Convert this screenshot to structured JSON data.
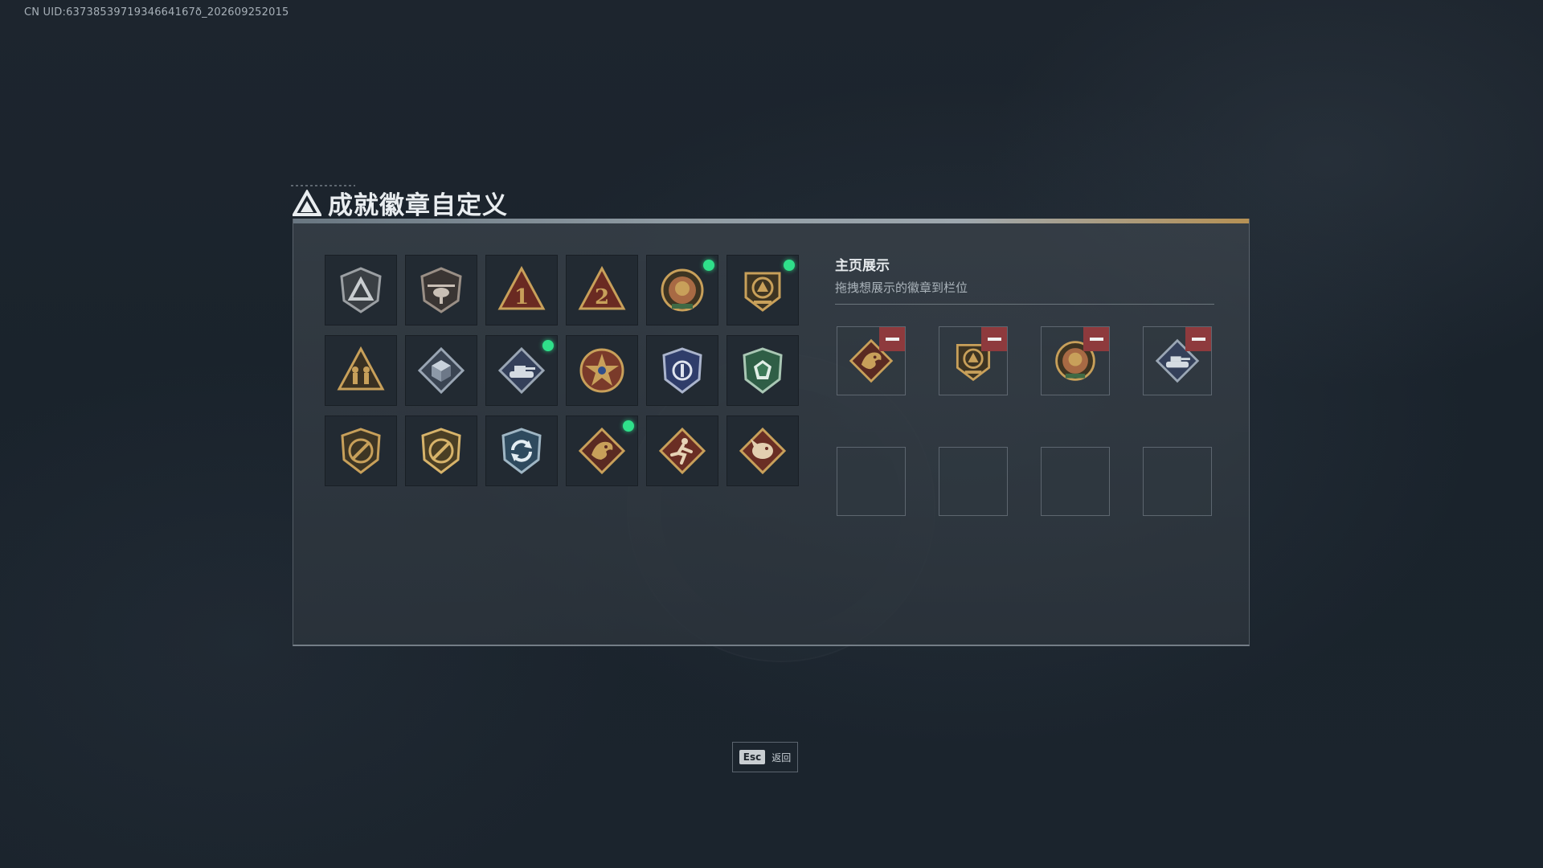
{
  "uid_text": "CN UID:6373853971934664167ð_202609252015",
  "title": "成就徽章自定义",
  "showcase": {
    "title": "主页展示",
    "subtitle": "拖拽想展示的徽章到栏位"
  },
  "esc": {
    "key": "Esc",
    "label": "返回"
  },
  "colors": {
    "new_dot": "#2fe08a",
    "remove_button": "#8e3a3d",
    "gold": "#c8a05a",
    "bronze": "#a86a44"
  },
  "badges": [
    {
      "icon": "delta-triangle-shield-badge-icon",
      "new": false
    },
    {
      "icon": "helicopter-shield-badge-icon",
      "new": false
    },
    {
      "icon": "rank-1-triangle-badge-icon",
      "new": false
    },
    {
      "icon": "rank-2-triangle-badge-icon",
      "new": false
    },
    {
      "icon": "lion-crest-badge-icon",
      "new": true
    },
    {
      "icon": "delta-force-2026-crest-badge-icon",
      "new": true
    },
    {
      "icon": "soldiers-triangle-badge-icon",
      "new": false
    },
    {
      "icon": "cube-diamond-badge-icon",
      "new": false
    },
    {
      "icon": "tank-diamond-badge-icon",
      "new": true
    },
    {
      "icon": "star-medal-badge-icon",
      "new": false
    },
    {
      "icon": "police-shield-badge-icon",
      "new": false
    },
    {
      "icon": "green-gem-shield-badge-icon",
      "new": false
    },
    {
      "icon": "rifle-shield-badge-icon",
      "new": false
    },
    {
      "icon": "rifle-shield-gold-badge-icon",
      "new": false
    },
    {
      "icon": "recycle-arrows-badge-icon",
      "new": false
    },
    {
      "icon": "dragon-diamond-badge-icon",
      "new": true
    },
    {
      "icon": "runner-diamond-badge-icon",
      "new": false
    },
    {
      "icon": "beast-head-diamond-badge-icon",
      "new": false
    }
  ],
  "showcase_slots": [
    {
      "icon": "dragon-diamond-badge-icon",
      "filled": true
    },
    {
      "icon": "delta-force-2026-crest-badge-icon",
      "filled": true
    },
    {
      "icon": "lion-crest-badge-icon",
      "filled": true
    },
    {
      "icon": "tank-diamond-badge-icon",
      "filled": true
    },
    {
      "icon": "",
      "filled": false
    },
    {
      "icon": "",
      "filled": false
    },
    {
      "icon": "",
      "filled": false
    },
    {
      "icon": "",
      "filled": false
    }
  ]
}
